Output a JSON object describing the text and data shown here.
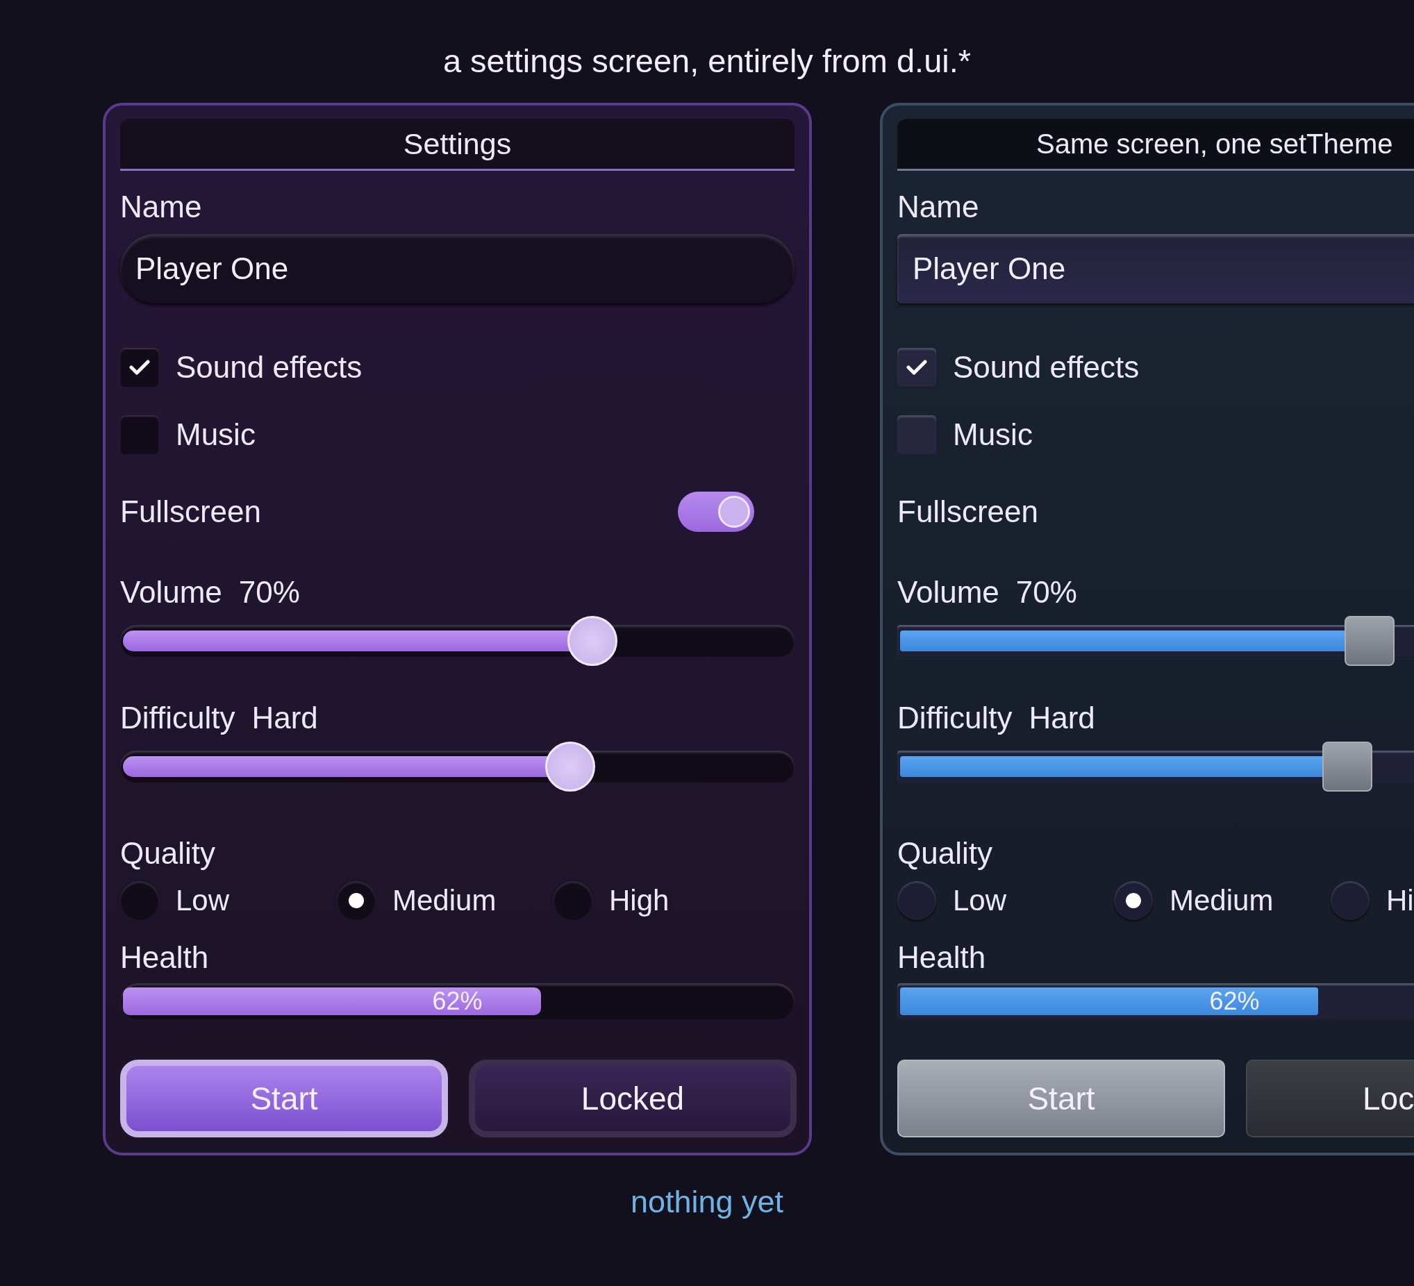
{
  "caption": "a settings screen, entirely from d.ui.*",
  "panels": [
    {
      "kind": "violet",
      "title": "Settings",
      "fields": [
        {
          "kind": "text_input",
          "label": "Name",
          "value": "Player One"
        },
        {
          "kind": "checkbox",
          "label": "Sound effects",
          "checked": true
        },
        {
          "kind": "checkbox",
          "label": "Music",
          "checked": false
        },
        {
          "kind": "toggle",
          "label": "Fullscreen",
          "on": true
        },
        {
          "kind": "slider",
          "label": "Volume",
          "reading": "70%",
          "level": 0.7
        },
        {
          "kind": "slider",
          "label": "Difficulty",
          "reading": "Hard",
          "level": 0.667
        },
        {
          "kind": "radio_group",
          "label": "Quality",
          "options": [
            {
              "label": "Low",
              "selected": false
            },
            {
              "label": "Medium",
              "selected": true
            },
            {
              "label": "High",
              "selected": false
            }
          ]
        },
        {
          "kind": "progress",
          "label": "Health",
          "reading": "62%",
          "level": 0.62
        },
        {
          "kind": "buttons",
          "buttons": [
            {
              "label": "Start",
              "kind": "primary"
            },
            {
              "label": "Locked",
              "kind": "secondary"
            }
          ]
        }
      ]
    },
    {
      "kind": "steel",
      "title": "Same screen, one setTheme",
      "fields": [
        {
          "kind": "text_input",
          "label": "Name",
          "value": "Player One"
        },
        {
          "kind": "checkbox",
          "label": "Sound effects",
          "checked": true
        },
        {
          "kind": "checkbox",
          "label": "Music",
          "checked": false
        },
        {
          "kind": "toggle",
          "label": "Fullscreen"
        },
        {
          "kind": "slider",
          "label": "Volume",
          "reading": "70%",
          "level": 0.7
        },
        {
          "kind": "slider",
          "label": "Difficulty",
          "reading": "Hard",
          "level": 0.667
        },
        {
          "kind": "radio_group",
          "label": "Quality",
          "options": [
            {
              "label": "Low",
              "selected": false
            },
            {
              "label": "Medium",
              "selected": true
            },
            {
              "label": "Hi",
              "selected": false
            }
          ]
        },
        {
          "kind": "progress",
          "label": "Health",
          "reading": "62%",
          "level": 0.62
        },
        {
          "kind": "buttons",
          "buttons": [
            {
              "label": "Start",
              "kind": "primary"
            },
            {
              "label": "Loc",
              "kind": "secondary"
            }
          ]
        }
      ]
    }
  ],
  "status": "nothing yet"
}
